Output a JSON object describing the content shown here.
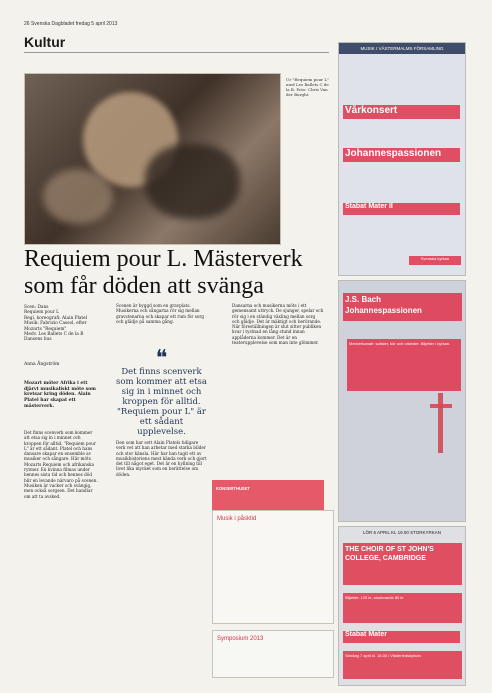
{
  "newspaper": {
    "folio": "26  Svenska Dagbladet fredag 5 april 2013",
    "section": "Kultur"
  },
  "photo": {
    "caption": "Ur \"Requiem pour L\" med Les Ballets C de la B. Foto: Chris Van der Burght."
  },
  "article": {
    "headline": "Requiem pour L. Mästerverk som får döden att svänga",
    "meta": "Scen: Dans\nRequiem pour L\nRegi, koreografi: Alain Platel\nMusik: Fabrizio Cassol, efter Mozarts \"Requiem\"\nMedv. Les Ballets C de la B\nDansens hus",
    "author": "Anna Ångström",
    "ingress": "Mozart möter Afrika i ett djärvt musikaliskt möte som kretsar kring döden. Alain Platel har skapat ett mästerverk.",
    "col1": "Det finns scenverk som kommer att etsa sig in i minnet och kroppen för alltid. \"Requiem pour L\" är ett sådant. Platel och hans dansare skapar en ensemble av musiker och sångare. Här möts Mozarts Requiem och afrikanska rytmer. En kvinna filmas under hennes sista tid och hennes död blir en levande närvaro på scenen. Musiken är vacker och svängig, men också sorgsen. Det handlar om att ta avsked.",
    "col2": "Scenen är byggd som en gravplats. Musikerna och sångarna rör sig mellan gravstenarna och skapar ett rum för sorg och glädje på samma gång.",
    "quote": "Det finns scenverk som kommer att etsa sig in i minnet och kroppen för alltid. \"Requiem pour L\" är ett sådant upplevelse.",
    "col2b": "Den som har sett Alain Platels tidigare verk vet att han arbetar med starka bilder och stor känsla. Här har han tagit ett av musikhistoriens mest kända verk och gjort det till något eget. Det är en hyllning till livet lika mycket som en berättelse om döden.",
    "col3": "Dansarna och musikerna möts i ett gemensamt uttryck. De sjunger, spelar och rör sig i en ständig växling mellan sorg och glädje. Det är mäktigt och berörande. När föreställningen är slut sitter publiken kvar i tystnad en lång stund innan applåderna kommer. Det är en teaterupplevelse som man inte glömmer."
  },
  "ads": {
    "church1": {
      "band": "MUSIK I VÄSTERMALMS FÖRSAMLING",
      "title1": "Vårkonsert",
      "title2": "Johannespassionen",
      "title3": "Stabat Mater II",
      "footer": "Svenska kyrkan"
    },
    "concert": {
      "title": "J.S. Bach Johannespassionen",
      "details": "Medverkande: solister, kör och orkester. Biljetter i kyrkan."
    },
    "choir": {
      "date": "LÖR 6 APRIL KL 19.00 STORKYRKAN",
      "title": "THE CHOIR OF ST JOHN'S COLLEGE, CAMBRIDGE",
      "info": "Biljetter: 120 kr, studerande 80 kr"
    },
    "stabat": {
      "title": "Stabat Mater",
      "details": "Söndag 7 april kl. 18.00 i Västerledskyrkan"
    }
  },
  "middle_ads": {
    "red_header": "KONSERTHUSET",
    "box2_title": "Musik i påsktid",
    "box3_title": "Symposium 2013"
  }
}
